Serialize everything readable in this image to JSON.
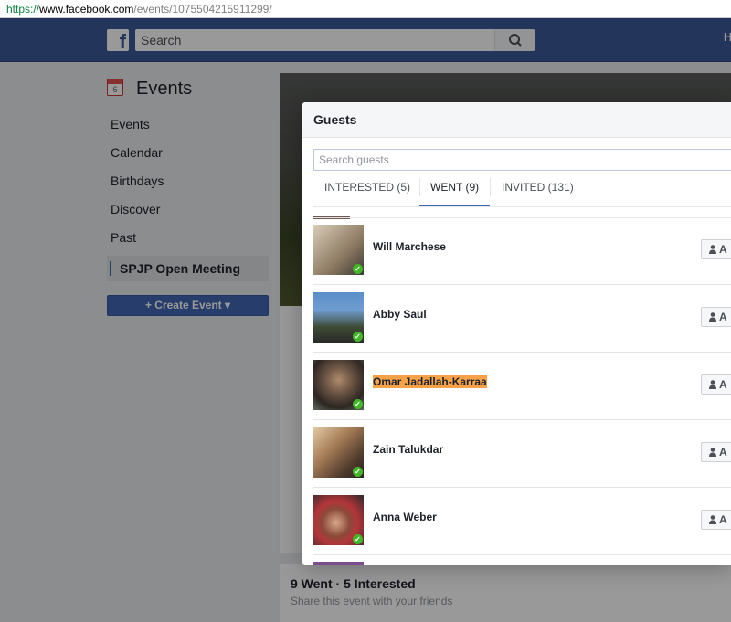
{
  "browser": {
    "url_scheme": "https://",
    "url_host": "www.facebook.com",
    "url_path": "/events/1075504215911299/"
  },
  "header": {
    "logo": "f",
    "search_placeholder": "Search",
    "right_partial": "H"
  },
  "sidebar": {
    "title": "Events",
    "calendar_day": "6",
    "items": [
      {
        "label": "Events"
      },
      {
        "label": "Calendar"
      },
      {
        "label": "Birthdays"
      },
      {
        "label": "Discover"
      },
      {
        "label": "Past"
      }
    ],
    "active_item": "SPJP Open Meeting",
    "create_button": "Create Event"
  },
  "event_card": {
    "summary": "9 Went · 5 Interested",
    "share_prompt": "Share this event with your friends"
  },
  "guests_modal": {
    "title": "Guests",
    "search_placeholder": "Search guests",
    "tabs": [
      {
        "label": "INTERESTED (5)",
        "active": false
      },
      {
        "label": "WENT (9)",
        "active": true
      },
      {
        "label": "INVITED (131)",
        "active": false
      }
    ],
    "add_button_label": "A",
    "guests": [
      {
        "name": "Will Marchese",
        "highlighted": false,
        "avatar_color": "#b9a68d"
      },
      {
        "name": "Abby Saul",
        "highlighted": false,
        "avatar_color": "#5b7fa8"
      },
      {
        "name": "Omar Jadallah-Karraa",
        "highlighted": true,
        "avatar_color": "#4d3e33"
      },
      {
        "name": "Zain Talukdar",
        "highlighted": false,
        "avatar_color": "#8a6a4e"
      },
      {
        "name": "Anna Weber",
        "highlighted": false,
        "avatar_color": "#9b3a3a"
      }
    ]
  },
  "colors": {
    "facebook_blue": "#3b5998",
    "button_blue": "#4267b2",
    "highlight": "#f7a249",
    "went_check": "#42b72a"
  }
}
